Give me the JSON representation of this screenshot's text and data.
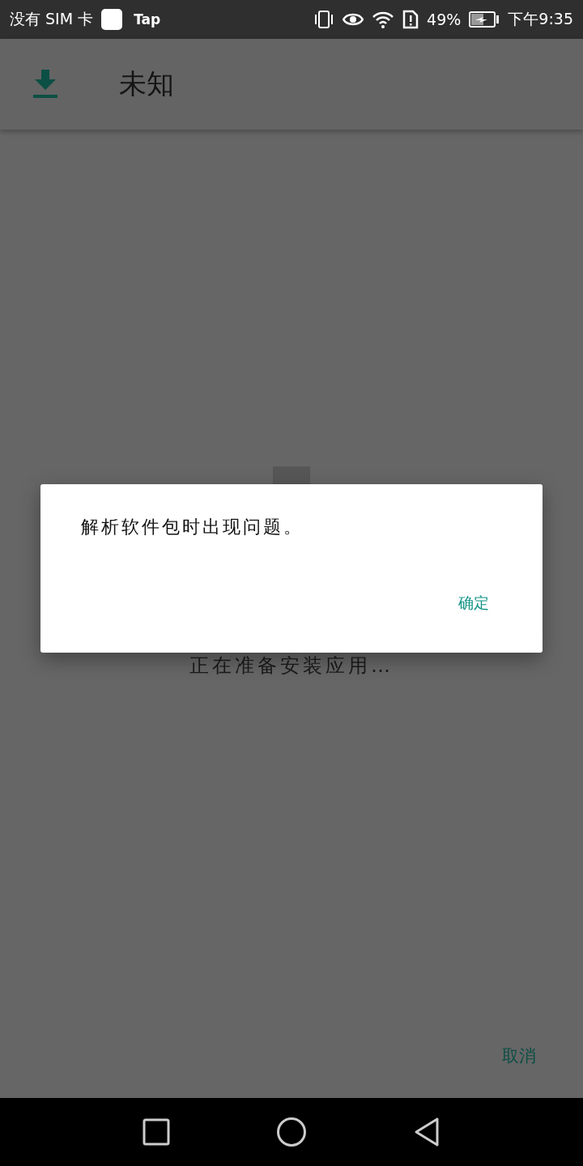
{
  "status_bar": {
    "carrier": "没有 SIM 卡",
    "app_label": "Tap",
    "battery": "49%",
    "time": "下午9:35"
  },
  "app_bar": {
    "title": "未知"
  },
  "installer": {
    "status": "正在准备安装应用…",
    "cancel": "取消"
  },
  "dialog": {
    "message": "解析软件包时出现问题。",
    "button": "确定"
  }
}
